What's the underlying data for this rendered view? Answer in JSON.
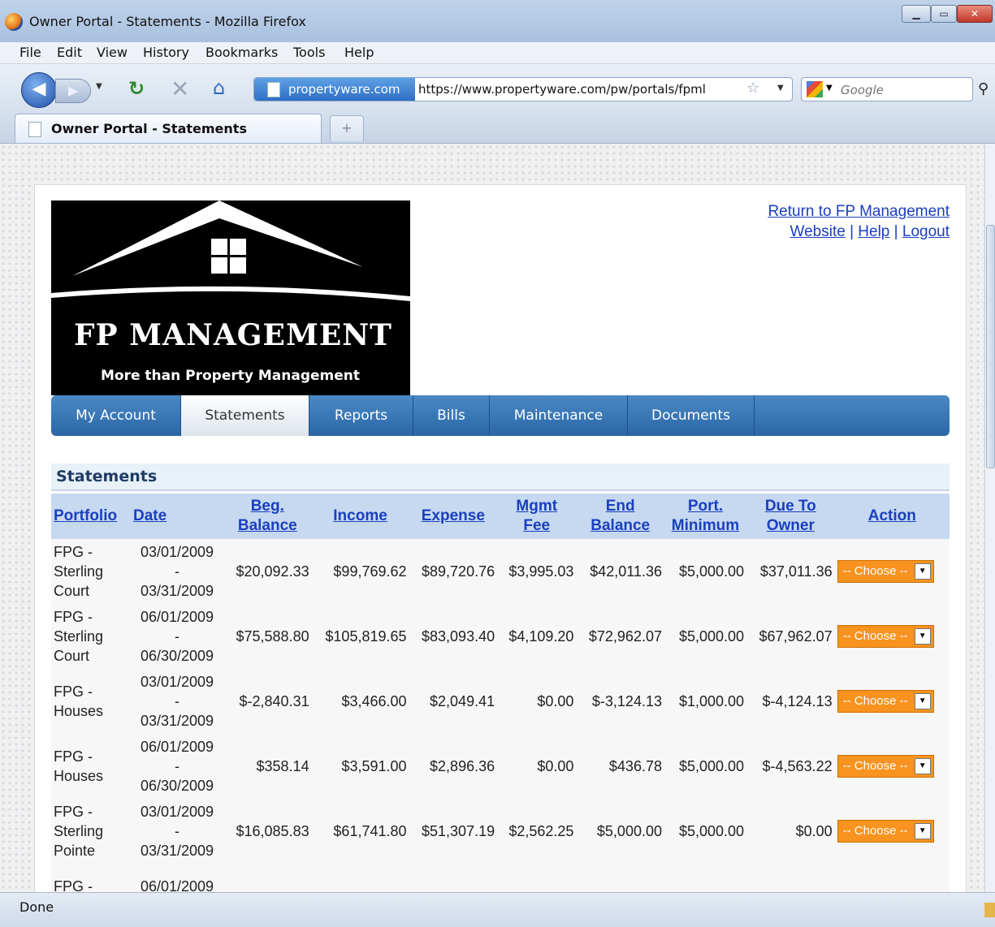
{
  "window": {
    "title": "Owner Portal - Statements - Mozilla Firefox"
  },
  "menu": [
    "File",
    "Edit",
    "View",
    "History",
    "Bookmarks",
    "Tools",
    "Help"
  ],
  "nav": {
    "site_identity": "propertyware.com",
    "url": "https://www.propertyware.com/pw/portals/fpml",
    "search_placeholder": "Google"
  },
  "tab": {
    "title": "Owner Portal - Statements",
    "new_tab": "+"
  },
  "page": {
    "logo": {
      "name": "FP Management",
      "tagline": "More than Property Management"
    },
    "links": {
      "return": "Return to FP Management",
      "website": "Website",
      "help": "Help",
      "logout": "Logout",
      "sep": "|"
    },
    "tabs": [
      "My Account",
      "Statements",
      "Reports",
      "Bills",
      "Maintenance",
      "Documents"
    ],
    "active_tab": "Statements",
    "section_title": "Statements",
    "columns": {
      "portfolio": "Portfolio",
      "date": "Date",
      "beg_line1": "Beg.",
      "beg_line2": "Balance",
      "income": "Income",
      "expense": "Expense",
      "mgmt_line1": "Mgmt",
      "mgmt_line2": "Fee",
      "end_line1": "End",
      "end_line2": "Balance",
      "port_line1": "Port.",
      "port_line2": "Minimum",
      "due_line1": "Due To",
      "due_line2": "Owner",
      "action": "Action"
    },
    "rows": [
      {
        "p1": "FPG -",
        "p2": "Sterling",
        "p3": "Court",
        "d1": "03/01/2009",
        "d2": "-",
        "d3": "03/31/2009",
        "beg": "$20,092.33",
        "income": "$99,769.62",
        "expense": "$89,720.76",
        "mgmt": "$3,995.03",
        "end": "$42,011.36",
        "min": "$5,000.00",
        "due": "$37,011.36",
        "action": "-- Choose --"
      },
      {
        "p1": "FPG -",
        "p2": "Sterling",
        "p3": "Court",
        "d1": "06/01/2009",
        "d2": "-",
        "d3": "06/30/2009",
        "beg": "$75,588.80",
        "income": "$105,819.65",
        "expense": "$83,093.40",
        "mgmt": "$4,109.20",
        "end": "$72,962.07",
        "min": "$5,000.00",
        "due": "$67,962.07",
        "action": "-- Choose --"
      },
      {
        "p1": "FPG -",
        "p2": "Houses",
        "p3": "",
        "d1": "03/01/2009",
        "d2": "-",
        "d3": "03/31/2009",
        "beg": "$-2,840.31",
        "income": "$3,466.00",
        "expense": "$2,049.41",
        "mgmt": "$0.00",
        "end": "$-3,124.13",
        "min": "$1,000.00",
        "due": "$-4,124.13",
        "action": "-- Choose --"
      },
      {
        "p1": "FPG -",
        "p2": "Houses",
        "p3": "",
        "d1": "06/01/2009",
        "d2": "-",
        "d3": "06/30/2009",
        "beg": "$358.14",
        "income": "$3,591.00",
        "expense": "$2,896.36",
        "mgmt": "$0.00",
        "end": "$436.78",
        "min": "$5,000.00",
        "due": "$-4,563.22",
        "action": "-- Choose --"
      },
      {
        "p1": "FPG -",
        "p2": "Sterling",
        "p3": "Pointe",
        "d1": "03/01/2009",
        "d2": "-",
        "d3": "03/31/2009",
        "beg": "$16,085.83",
        "income": "$61,741.80",
        "expense": "$51,307.19",
        "mgmt": "$2,562.25",
        "end": "$5,000.00",
        "min": "$5,000.00",
        "due": "$0.00",
        "action": "-- Choose --"
      },
      {
        "p1": "FPG -",
        "p2": "",
        "p3": "",
        "d1": "06/01/2009",
        "d2": "",
        "d3": "",
        "beg": "",
        "income": "",
        "expense": "",
        "mgmt": "",
        "end": "",
        "min": "",
        "due": "",
        "action": ""
      }
    ]
  },
  "status": {
    "text": "Done"
  },
  "icons": {
    "back": "back-arrow-icon",
    "forward": "forward-arrow-icon",
    "reload": "reload-icon",
    "stop": "stop-icon",
    "home": "home-icon",
    "bookmark": "star-icon",
    "search": "magnifier-icon"
  },
  "colors": {
    "nav_blue": "#2a66a6",
    "link": "#1a3fbf",
    "action_orange": "#f8931f",
    "header_row": "#c6d9f0"
  }
}
